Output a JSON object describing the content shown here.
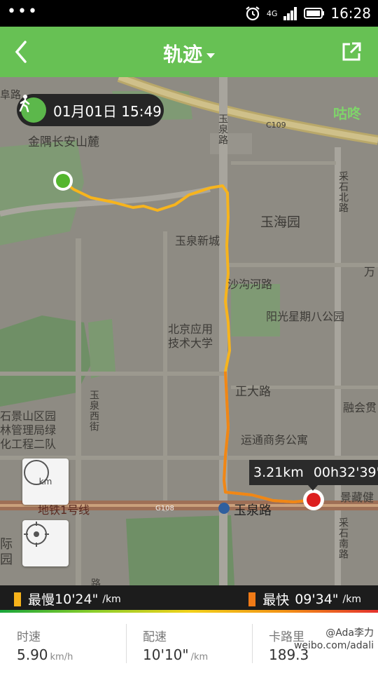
{
  "status_bar": {
    "time": "16:28",
    "network": "4G"
  },
  "header": {
    "title": "轨迹"
  },
  "map": {
    "start_time": "01月01日 15:49",
    "brand": "咕咚",
    "distance": "3.21km",
    "duration": "00h32'39\"",
    "zoom_button_label": "km",
    "labels": {
      "jinyu": "金隅长安山麓",
      "yuhaiyuan": "玉海园",
      "yuquanxincheng": "玉泉新城",
      "shaheluroad": "沙沟河路",
      "yangguang": "阳光星期八公园",
      "beijing_uni_1": "北京应用",
      "beijing_uni_2": "技术大学",
      "zhengda": "正大路",
      "yuntong": "运通商务公寓",
      "rongjiao": "融会贯",
      "wan": "万",
      "jingzang": "景藏健",
      "yuquanlu_station": "玉泉路",
      "subway": "地铁1号线",
      "yuquan_road_v": "玉泉路",
      "yuquan_west_v": "玉泉西街",
      "caishi_north_v": "采石北路",
      "caishi_south_v": "采石南路",
      "shijingshan_1": "石景山区园",
      "shijingshan_2": "林管理局绿",
      "shijingshan_3": "化工程二队",
      "ji": "际",
      "yuan": "园",
      "fuluroad": "阜路",
      "lu": "路",
      "c109": "C109",
      "g108": "G108"
    }
  },
  "pace": {
    "slow_label": "最慢",
    "slow_value": "10'24\"",
    "fast_label": "最快",
    "fast_value": "09'34\"",
    "unit": "/km",
    "slow_color": "#f6b21a",
    "fast_color": "#f07a16"
  },
  "stats": {
    "speed": {
      "label": "时速",
      "value": "5.90",
      "unit": "km/h"
    },
    "pace": {
      "label": "配速",
      "value": "10'10\"",
      "unit": "/km"
    },
    "calories": {
      "label": "卡路里",
      "value": "189.3"
    }
  },
  "watermark": {
    "line1": "@Ada李力",
    "line2": "weibo.com/adali"
  }
}
